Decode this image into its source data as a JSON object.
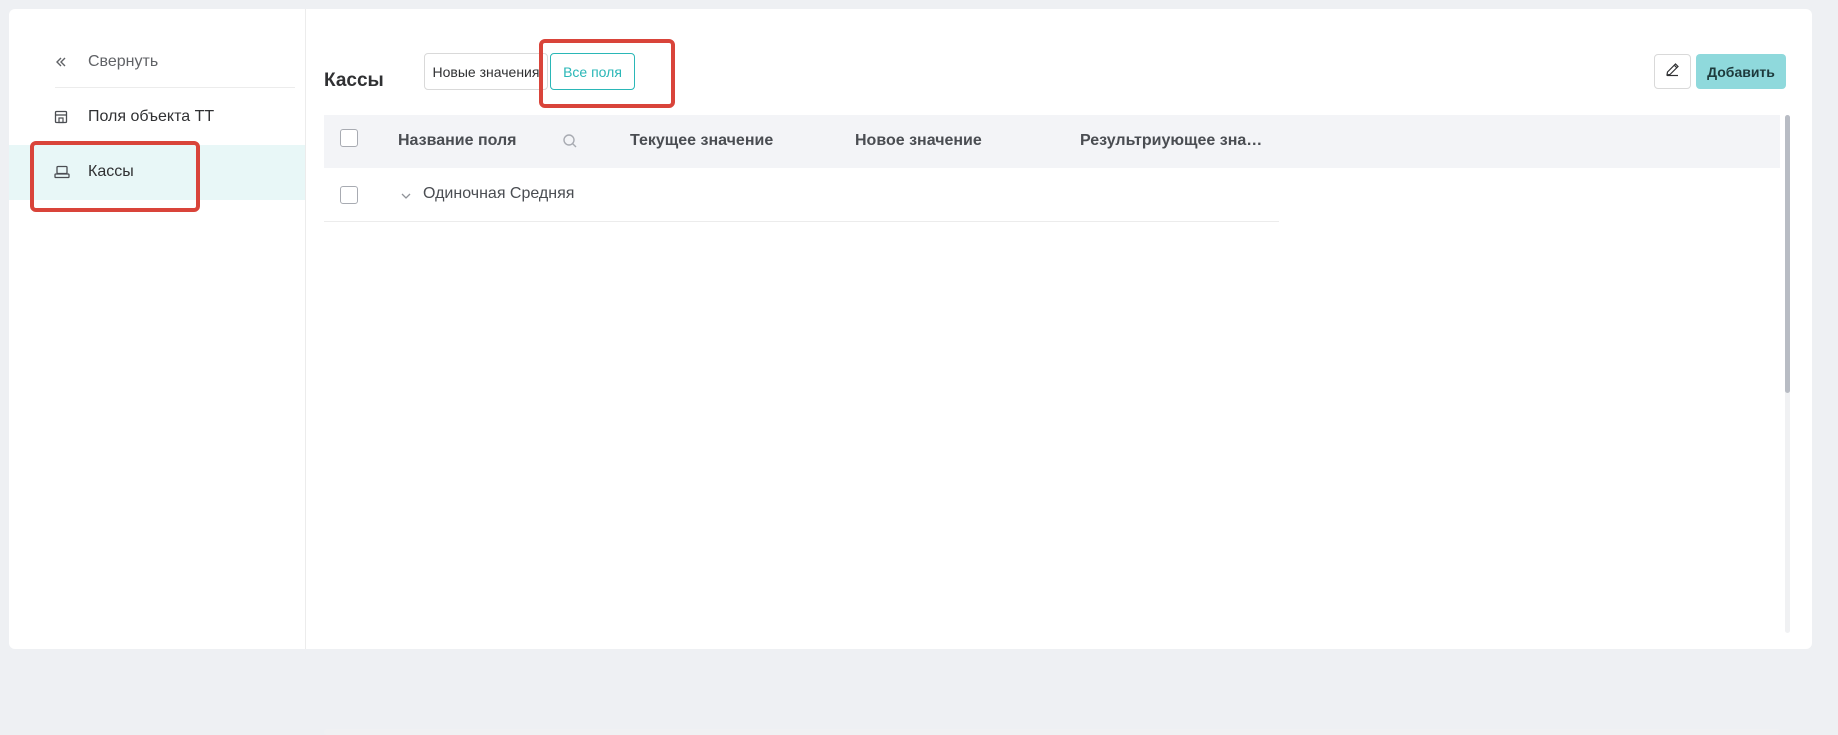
{
  "sidebar": {
    "collapse_label": "Свернуть",
    "items": [
      {
        "label": "Поля объекта ТТ",
        "icon": "store-icon"
      },
      {
        "label": "Кассы",
        "icon": "cash-register-icon",
        "active": true
      }
    ]
  },
  "main": {
    "title": "Кассы",
    "tabs": [
      {
        "label": "Новые значения",
        "active": false
      },
      {
        "label": "Все поля",
        "active": true
      }
    ],
    "edit_icon": "pencil-icon",
    "add_label": "Добавить"
  },
  "table": {
    "columns": [
      "Название поля",
      "Текущее значение",
      "Новое значение",
      "Результриующее зна…"
    ],
    "rows": [
      {
        "name": "Одиночная Средняя",
        "expandable": true
      }
    ]
  },
  "colors": {
    "accent": "#2ab7b7",
    "add_button_bg": "#8fd9dc",
    "active_item_bg": "#e8f7f7",
    "highlight": "#d9443a"
  }
}
